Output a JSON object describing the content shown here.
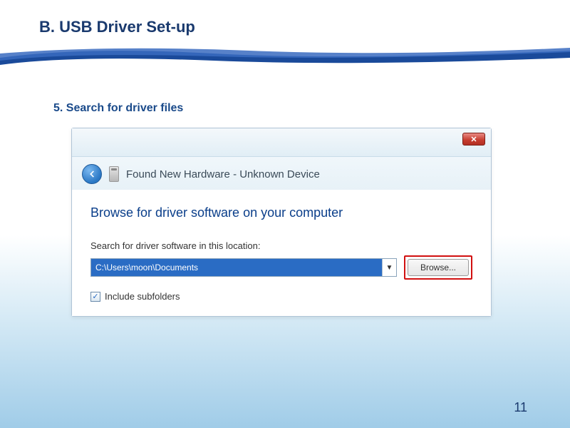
{
  "slide": {
    "title": "B. USB Driver Set-up",
    "sub_heading": "5. Search for driver files",
    "page_number": "11"
  },
  "dialog": {
    "header_text": "Found New Hardware - Unknown Device",
    "body_heading": "Browse for driver software on your computer",
    "field_label": "Search for driver software in this location:",
    "path_value": "C:\\Users\\moon\\Documents",
    "browse_label": "Browse...",
    "include_label": "Include subfolders",
    "checkmark": "✓"
  }
}
